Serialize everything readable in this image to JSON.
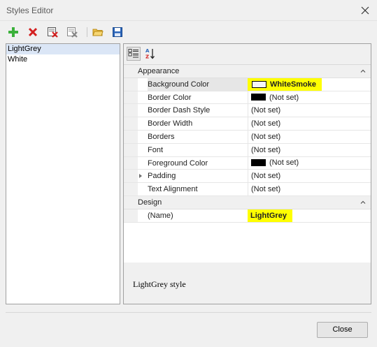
{
  "window": {
    "title": "Styles Editor"
  },
  "toolbar": {
    "buttons": [
      {
        "icon": "add-icon"
      },
      {
        "icon": "delete-icon"
      },
      {
        "icon": "delete-all-icon"
      },
      {
        "icon": "remove-unused-icon"
      },
      {
        "icon": "open-icon"
      },
      {
        "icon": "save-icon"
      }
    ]
  },
  "styles_list": {
    "items": [
      "LightGrey",
      "White"
    ],
    "selected": "LightGrey"
  },
  "property_grid": {
    "categories": [
      {
        "label": "Appearance",
        "properties": [
          {
            "name": "Background Color",
            "value": "WhiteSmoke",
            "swatch": "#f5f5f5",
            "highlighted": true
          },
          {
            "name": "Border Color",
            "value": "(Not set)",
            "swatch": "#000000"
          },
          {
            "name": "Border Dash Style",
            "value": "(Not set)"
          },
          {
            "name": "Border Width",
            "value": "(Not set)"
          },
          {
            "name": "Borders",
            "value": "(Not set)"
          },
          {
            "name": "Font",
            "value": "(Not set)"
          },
          {
            "name": "Foreground Color",
            "value": "(Not set)",
            "swatch": "#000000"
          },
          {
            "name": "Padding",
            "value": "(Not set)",
            "expandable": true
          },
          {
            "name": "Text Alignment",
            "value": "(Not set)"
          }
        ]
      },
      {
        "label": "Design",
        "properties": [
          {
            "name": "(Name)",
            "value": "LightGrey",
            "highlighted": true
          }
        ]
      }
    ],
    "description": "LightGrey style"
  },
  "footer": {
    "close_label": "Close"
  },
  "colors": {
    "highlight": "#ffff00",
    "selection": "#dbe6f6"
  }
}
